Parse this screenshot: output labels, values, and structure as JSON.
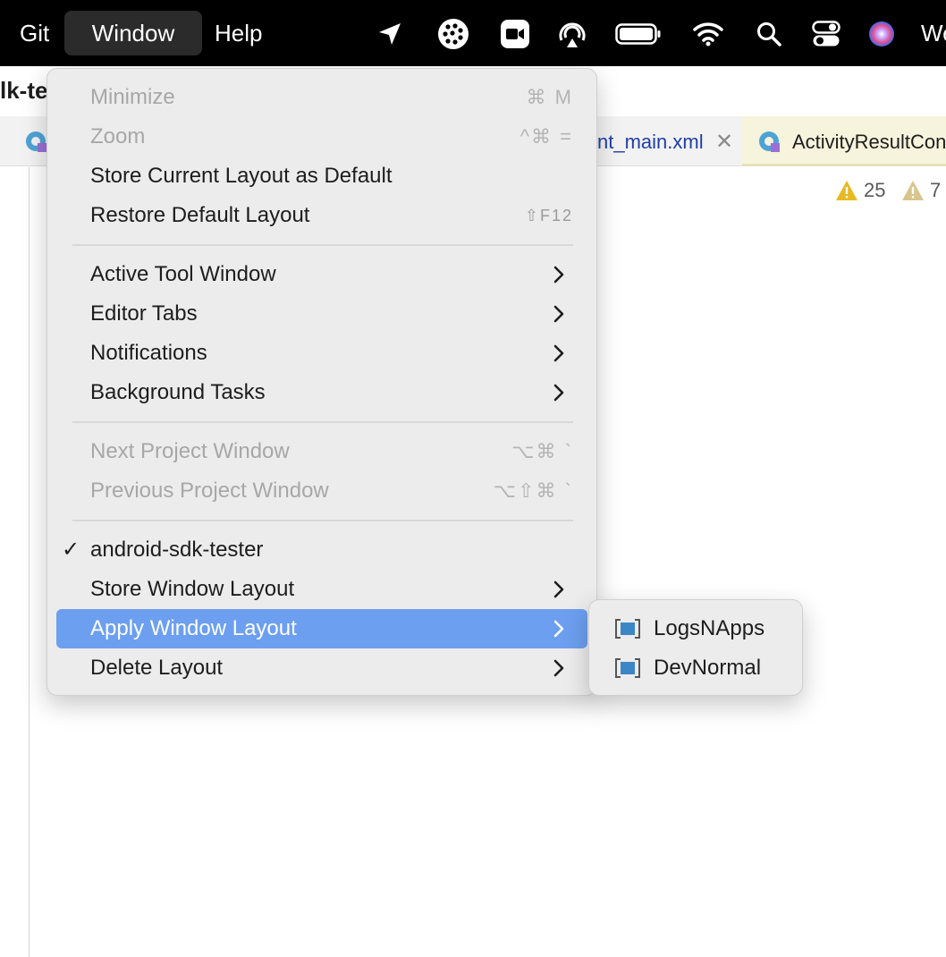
{
  "menubar": {
    "git": "Git",
    "window": "Window",
    "help": "Help",
    "tray_icons": [
      "location-icon",
      "dots-circle-icon",
      "video-camera-icon",
      "airplay-audio-icon",
      "battery-icon",
      "wifi-icon",
      "search-icon",
      "control-center-icon",
      "siri-icon"
    ],
    "clipped_text": "We"
  },
  "ide": {
    "title_clip": "lk-te",
    "tab_xml": "nt_main.xml",
    "tab_active": "ActivityResultCon",
    "warnings_count": "25",
    "weak_warnings_count": "7"
  },
  "window_menu": {
    "items": [
      {
        "label": "Minimize",
        "shortcut": "⌘ M",
        "disabled": true
      },
      {
        "label": "Zoom",
        "shortcut": "^⌘ =",
        "disabled": true
      },
      {
        "label": "Store Current Layout as Default"
      },
      {
        "label": "Restore Default Layout",
        "shortcut": "⇧F12"
      },
      {
        "label": "Active Tool Window",
        "submenu": true
      },
      {
        "label": "Editor Tabs",
        "submenu": true
      },
      {
        "label": "Notifications",
        "submenu": true
      },
      {
        "label": "Background Tasks",
        "submenu": true
      },
      {
        "label": "Next Project Window",
        "shortcut": "⌥⌘ `",
        "disabled": true
      },
      {
        "label": "Previous Project Window",
        "shortcut": "⌥⇧⌘ `",
        "disabled": true
      },
      {
        "label": "android-sdk-tester",
        "checked": true
      },
      {
        "label": "Store Window Layout",
        "submenu": true
      },
      {
        "label": "Apply Window Layout",
        "submenu": true,
        "highlighted": true
      },
      {
        "label": "Delete Layout",
        "submenu": true
      }
    ]
  },
  "apply_layout_submenu": {
    "items": [
      {
        "label": "LogsNApps"
      },
      {
        "label": "DevNormal"
      }
    ]
  },
  "colors": {
    "menu_bg": "#ececec",
    "highlight": "#6c9ff0",
    "menubar_bg": "#000000",
    "warning": "#e8b923"
  }
}
